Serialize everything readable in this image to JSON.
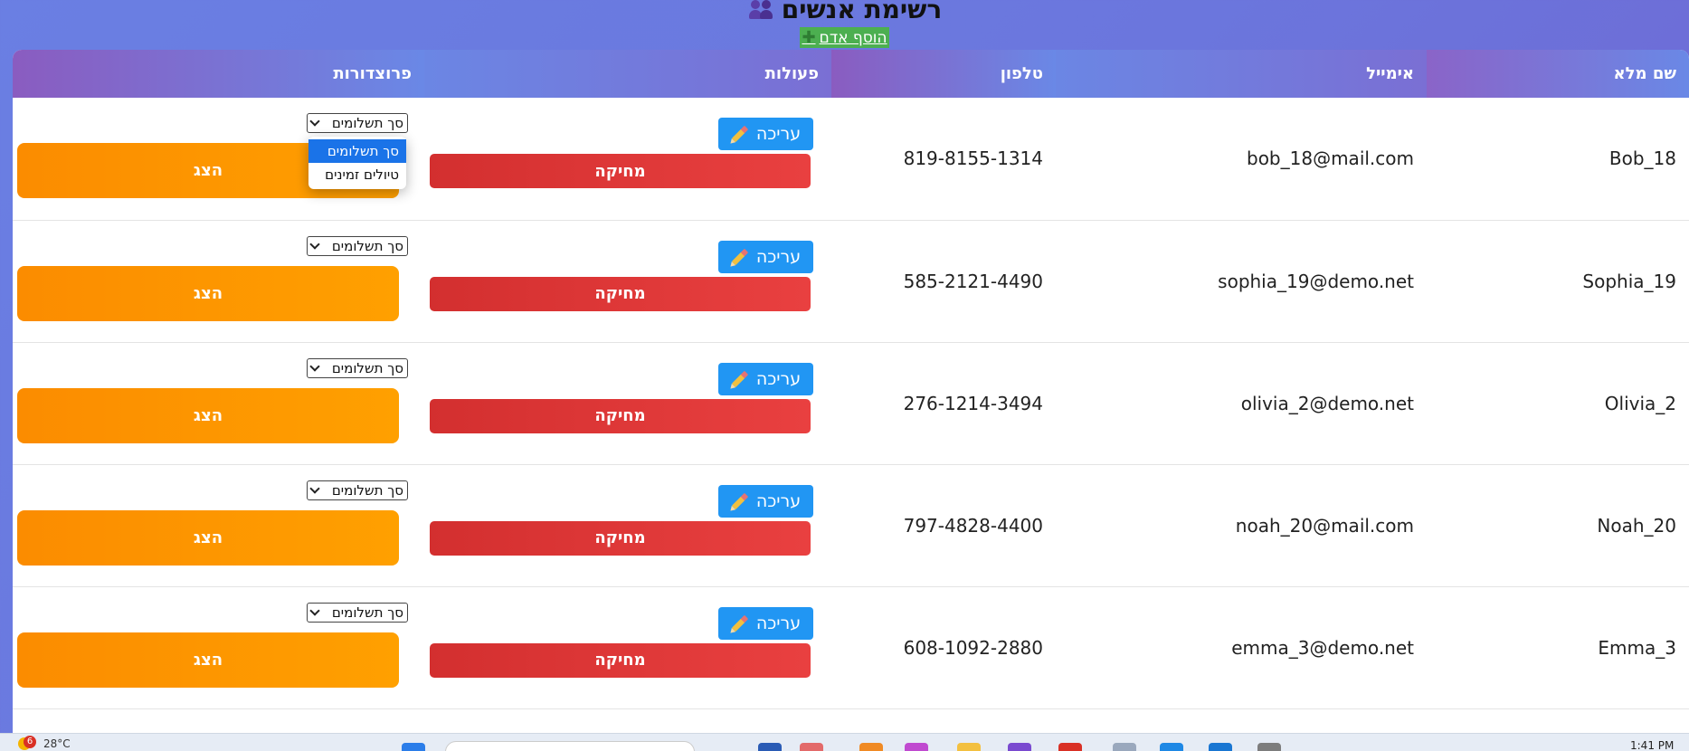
{
  "header": {
    "title": "רשימת אנשים",
    "add_person_label": "הוסף אדם"
  },
  "table": {
    "headers": {
      "full_name": "שם מלא",
      "email": "אימייל",
      "phone": "טלפון",
      "actions": "פעולות",
      "procedures": "פרוצדורות"
    },
    "rows": [
      {
        "name": "Bob_18",
        "email": "bob_18@mail.com",
        "phone": "819-8155-1314"
      },
      {
        "name": "Sophia_19",
        "email": "sophia_19@demo.net",
        "phone": "585-2121-4490"
      },
      {
        "name": "Olivia_2",
        "email": "olivia_2@demo.net",
        "phone": "276-1214-3494"
      },
      {
        "name": "Noah_20",
        "email": "noah_20@mail.com",
        "phone": "797-4828-4400"
      },
      {
        "name": "Emma_3",
        "email": "emma_3@demo.net",
        "phone": "608-1092-2880"
      }
    ],
    "edit_label": "עריכה",
    "delete_label": "מחיקה",
    "show_label": "הצג",
    "procedure_selected": "סך תשלומים",
    "procedure_options": [
      "סך תשלומים",
      "טיולים זמינים"
    ]
  },
  "taskbar": {
    "weather_temp": "28°C",
    "weather_badge": "6",
    "clock_time": "1:41 PM"
  }
}
